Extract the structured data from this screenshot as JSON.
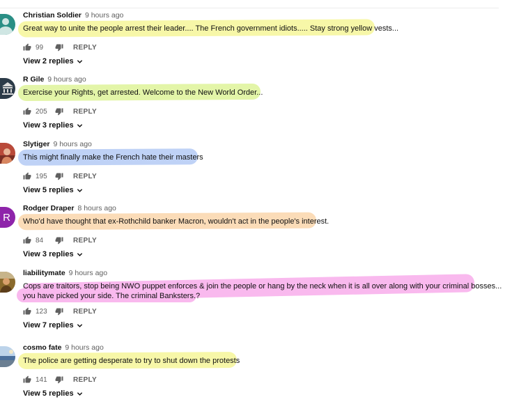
{
  "comments": [
    {
      "author": "Christian Soldier",
      "time": "9 hours ago",
      "text": "Great way to unite the people arrest their leader.... The French government idiots..... Stay strong yellow vests...",
      "likes": "99",
      "reply_label": "REPLY",
      "view_replies": "View 2 replies",
      "highlight_color": "#f7f7a8",
      "avatar_color": "#2a8f85",
      "avatar_icon": "person-silhouette-icon"
    },
    {
      "author": "R Gile",
      "time": "9 hours ago",
      "text": "Exercise your Rights, get arrested.  Welcome to the New World Order...",
      "likes": "205",
      "reply_label": "REPLY",
      "view_replies": "View 3 replies",
      "highlight_color": "#e3f5a8",
      "avatar_color": "#2b3a48",
      "avatar_icon": "badge-logo-icon"
    },
    {
      "author": "Slytiger",
      "time": "9 hours ago",
      "text": "This might finally make the French hate their masters",
      "likes": "195",
      "reply_label": "REPLY",
      "view_replies": "View 5 replies",
      "highlight_color": "#bfd2f6",
      "avatar_color": "#b94a3a",
      "avatar_icon": "photo-avatar-icon"
    },
    {
      "author": "Rodger Draper",
      "time": "8 hours ago",
      "text": "Who'd have thought that ex-Rothchild banker Macron, wouldn't act in the people's interest.",
      "likes": "84",
      "reply_label": "REPLY",
      "view_replies": "View 3 replies",
      "highlight_color": "#fbdcb8",
      "avatar_color": "#8e24aa",
      "avatar_letter": "R"
    },
    {
      "author": "liabilitymate",
      "time": "9 hours ago",
      "text_lines": [
        "Cops are traitors, stop being NWO puppet enforces & join the people or hang by the neck when it is all over along with your criminal bosses...",
        "you have picked your side. The criminal Banksters.?"
      ],
      "likes": "123",
      "reply_label": "REPLY",
      "view_replies": "View 7 replies",
      "highlight_color": "#f9b9ee",
      "avatar_color": "#8a6a2c",
      "avatar_icon": "photo-avatar-icon"
    },
    {
      "author": "cosmo fate",
      "time": "9 hours ago",
      "text": "The police are getting desperate to try to shut down the protests",
      "likes": "141",
      "reply_label": "REPLY",
      "view_replies": "View 5 replies",
      "highlight_color": "#f7f7a8",
      "avatar_color": "#4a6f9c",
      "avatar_icon": "landscape-photo-icon"
    }
  ]
}
